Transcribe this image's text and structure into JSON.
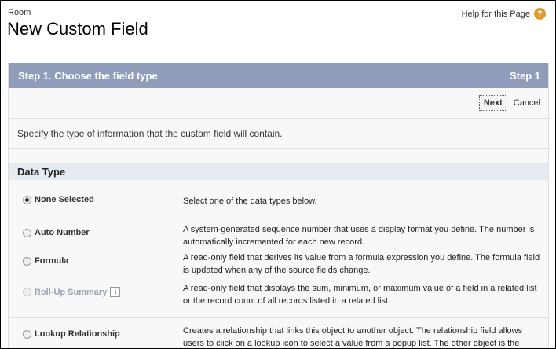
{
  "header": {
    "object": "Room",
    "title": "New Custom Field",
    "help": "Help for this Page",
    "help_icon": "question-circle-icon",
    "help_icon_glyph": "?"
  },
  "step": {
    "title": "Step 1. Choose the field type",
    "indicator": "Step 1",
    "color": "#8f9dba"
  },
  "buttons": {
    "next": "Next",
    "cancel": "Cancel"
  },
  "instructions": "Specify the type of information that the custom field will contain.",
  "section": {
    "title": "Data Type"
  },
  "types": [
    {
      "label": "None Selected",
      "selected": true,
      "disabled": false,
      "desc": "Select one of the data types below."
    },
    {
      "label": "Auto Number",
      "selected": false,
      "disabled": false,
      "desc": "A system-generated sequence number that uses a display format you define. The number is automatically incremented for each new record."
    },
    {
      "label": "Formula",
      "selected": false,
      "disabled": false,
      "desc": "A read-only field that derives its value from a formula expression you define. The formula field is updated when any of the source fields change."
    },
    {
      "label": "Roll-Up Summary",
      "selected": false,
      "disabled": true,
      "info": "i",
      "desc": "A read-only field that displays the sum, minimum, or maximum value of a field in a related list or the record count of all records listed in a related list."
    },
    {
      "label": "Lookup Relationship",
      "selected": false,
      "disabled": false,
      "desc": "Creates a relationship that links this object to another object. The relationship field allows users to click on a lookup icon to select a value from a popup list. The other object is the"
    }
  ]
}
